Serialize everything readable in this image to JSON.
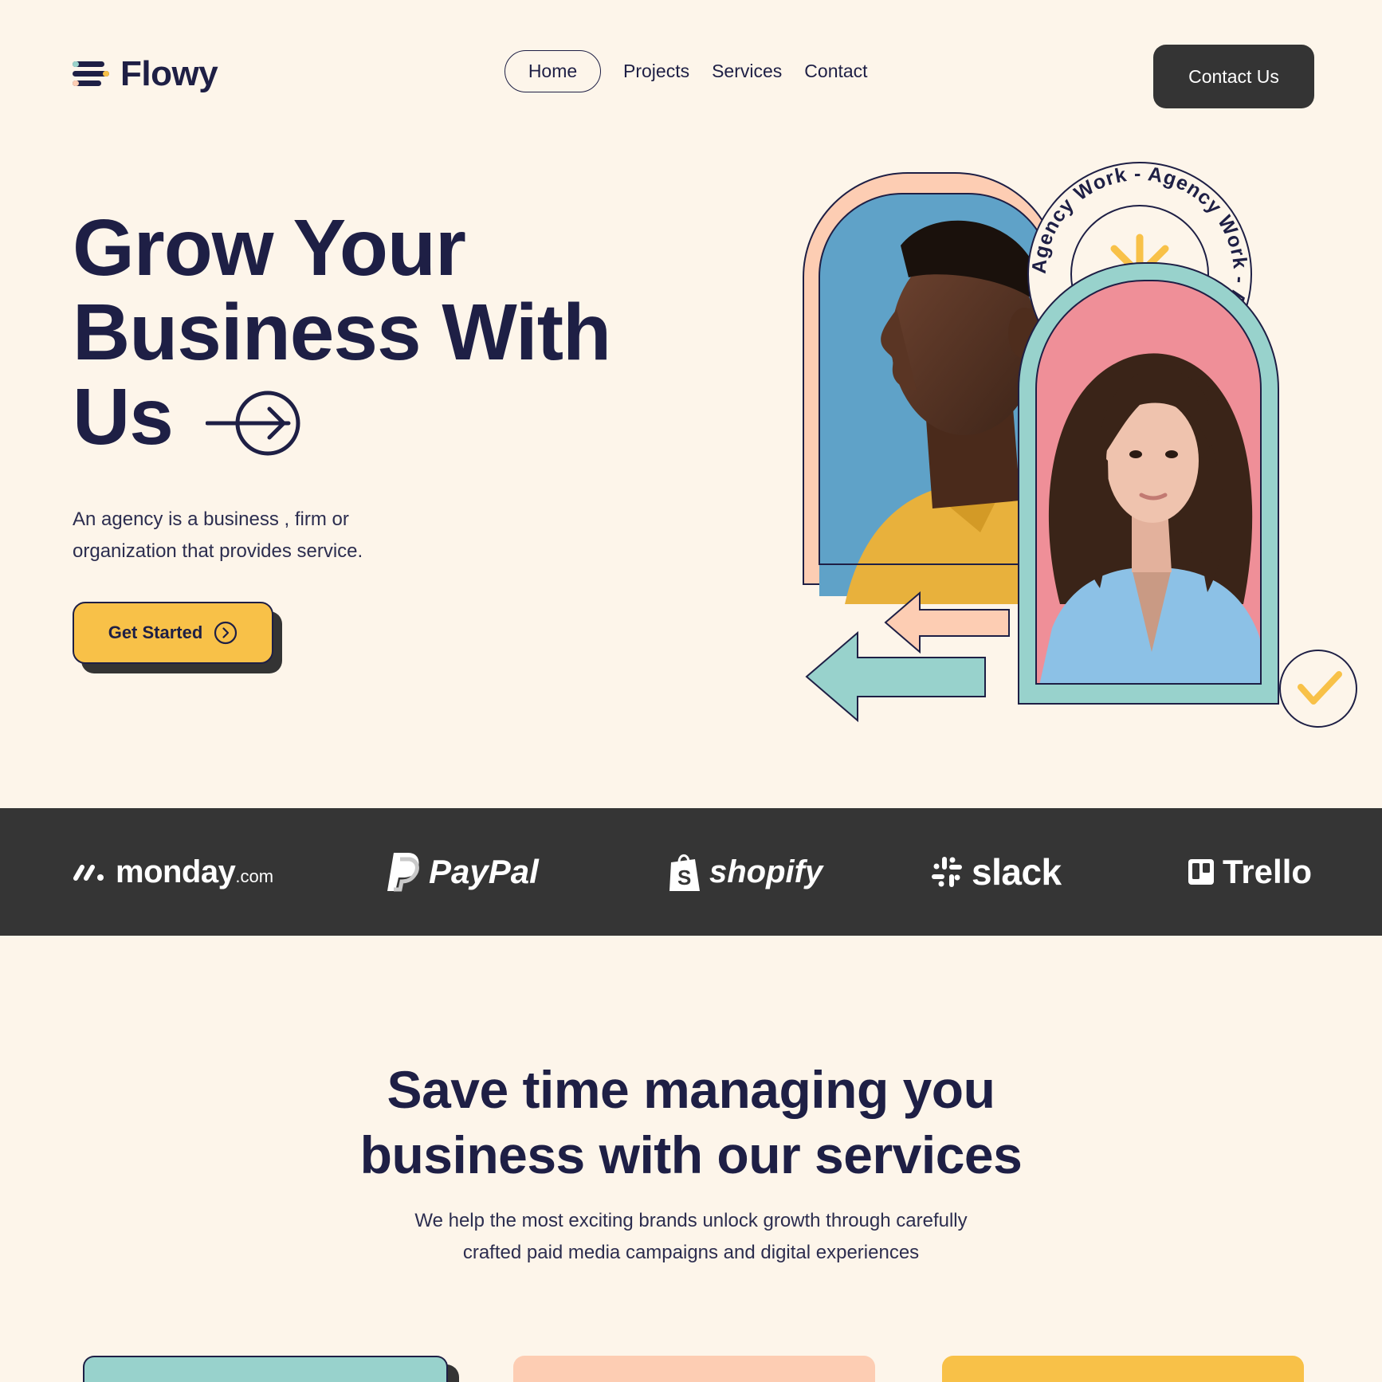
{
  "header": {
    "logo_text": "Flowy",
    "nav": [
      "Home",
      "Projects",
      "Services",
      "Contact"
    ],
    "contact_button": "Contact Us"
  },
  "hero": {
    "title_line1": "Grow Your",
    "title_line2": "Business With",
    "title_line3": "Us",
    "subtitle": "An agency is a business , firm or organization that provides service.",
    "cta_label": "Get Started",
    "badge_text": "Agency Work - Agency Work - Agency Work - "
  },
  "brands": {
    "monday": "monday",
    "monday_suffix": ".com",
    "paypal": "PayPal",
    "shopify": "shopify",
    "slack": "slack",
    "trello": "Trello"
  },
  "services": {
    "title_line1": "Save time managing you",
    "title_line2": "business with our services",
    "subtitle_line1": "We help the most exciting brands unlock growth through carefully",
    "subtitle_line2": "crafted paid media campaigns and digital experiences"
  },
  "colors": {
    "background": "#fdf5ea",
    "navy": "#1e1f45",
    "dark": "#343434",
    "yellow": "#f8c148",
    "peach": "#fdcdb3",
    "teal": "#98d2cc",
    "pink": "#ef8f98",
    "sky": "#5fa2c8"
  },
  "icons": [
    "menu-lines-icon",
    "arrow-circle-right-icon",
    "chevron-circle-right-icon",
    "asterisk-icon",
    "check-icon",
    "arrow-left-icon"
  ]
}
